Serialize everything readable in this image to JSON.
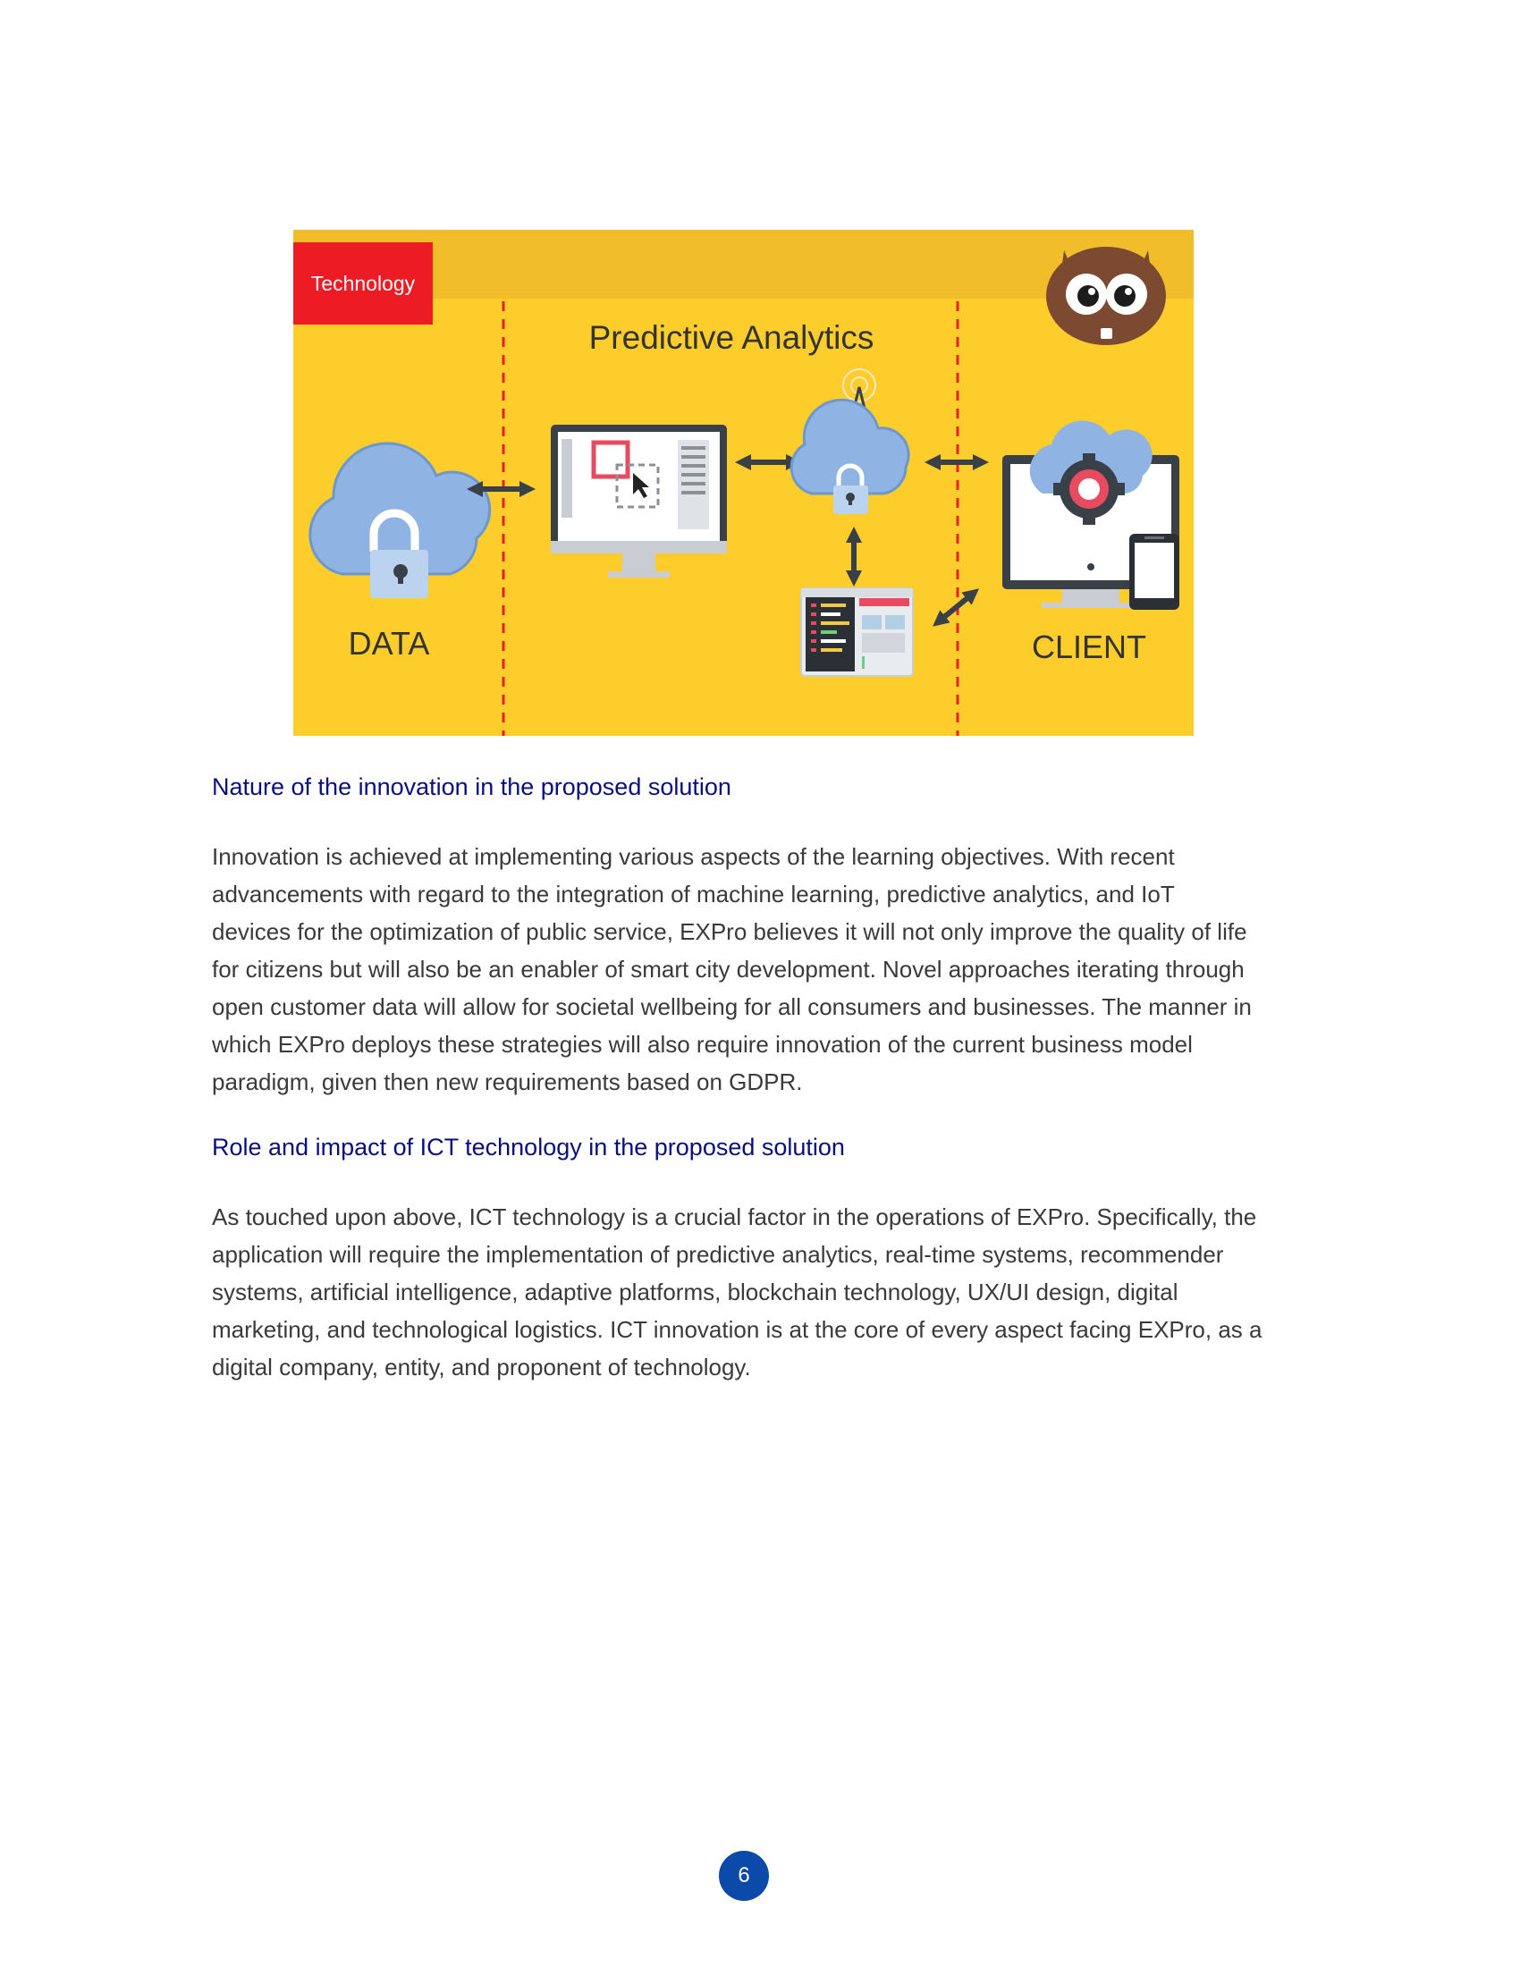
{
  "figure": {
    "tag": "Technology",
    "heading": "Predictive Analytics",
    "left_label": "DATA",
    "right_label": "CLIENT",
    "colors": {
      "background": "#fdcd2b",
      "top_band": "#f2bd2a",
      "tag": "#ed1c24",
      "divider": "#e8202a",
      "cloud": "#8fb4e3",
      "dark": "#3a4048"
    },
    "icons": [
      "beaver-mascot-icon",
      "cloud-lock-icon",
      "monitor-dashboard-icon",
      "cloud-antenna-lock-icon",
      "code-window-icon",
      "devices-gear-icon"
    ]
  },
  "sections": [
    {
      "heading": "Nature of the innovation in the proposed solution",
      "lines": [
        "Innovation is achieved at implementing various aspects of the learning objectives. With recent",
        "advancements with regard to the integration of machine learning, predictive analytics, and IoT",
        "devices for the optimization of public service, EXPro believes it will not only improve the quality of life",
        "for citizens but will also be an enabler of smart city development. Novel approaches iterating through",
        "open customer data will allow for societal wellbeing for all consumers and businesses. The manner in",
        "which EXPro deploys these strategies will also require innovation of the current business model",
        "paradigm, given then new requirements based on GDPR."
      ]
    },
    {
      "heading": "Role and impact of ICT technology in the proposed solution",
      "lines": [
        "As touched upon above, ICT technology is a crucial factor in the operations of EXPro. Specifically, the",
        "application will require the implementation of predictive analytics, real-time systems, recommender",
        "systems, artificial intelligence, adaptive platforms, blockchain technology, UX/UI design, digital",
        "marketing, and technological logistics. ICT innovation is at the core of every aspect facing EXPro, as a",
        "digital company, entity, and proponent of technology."
      ]
    }
  ],
  "page_number": "6"
}
